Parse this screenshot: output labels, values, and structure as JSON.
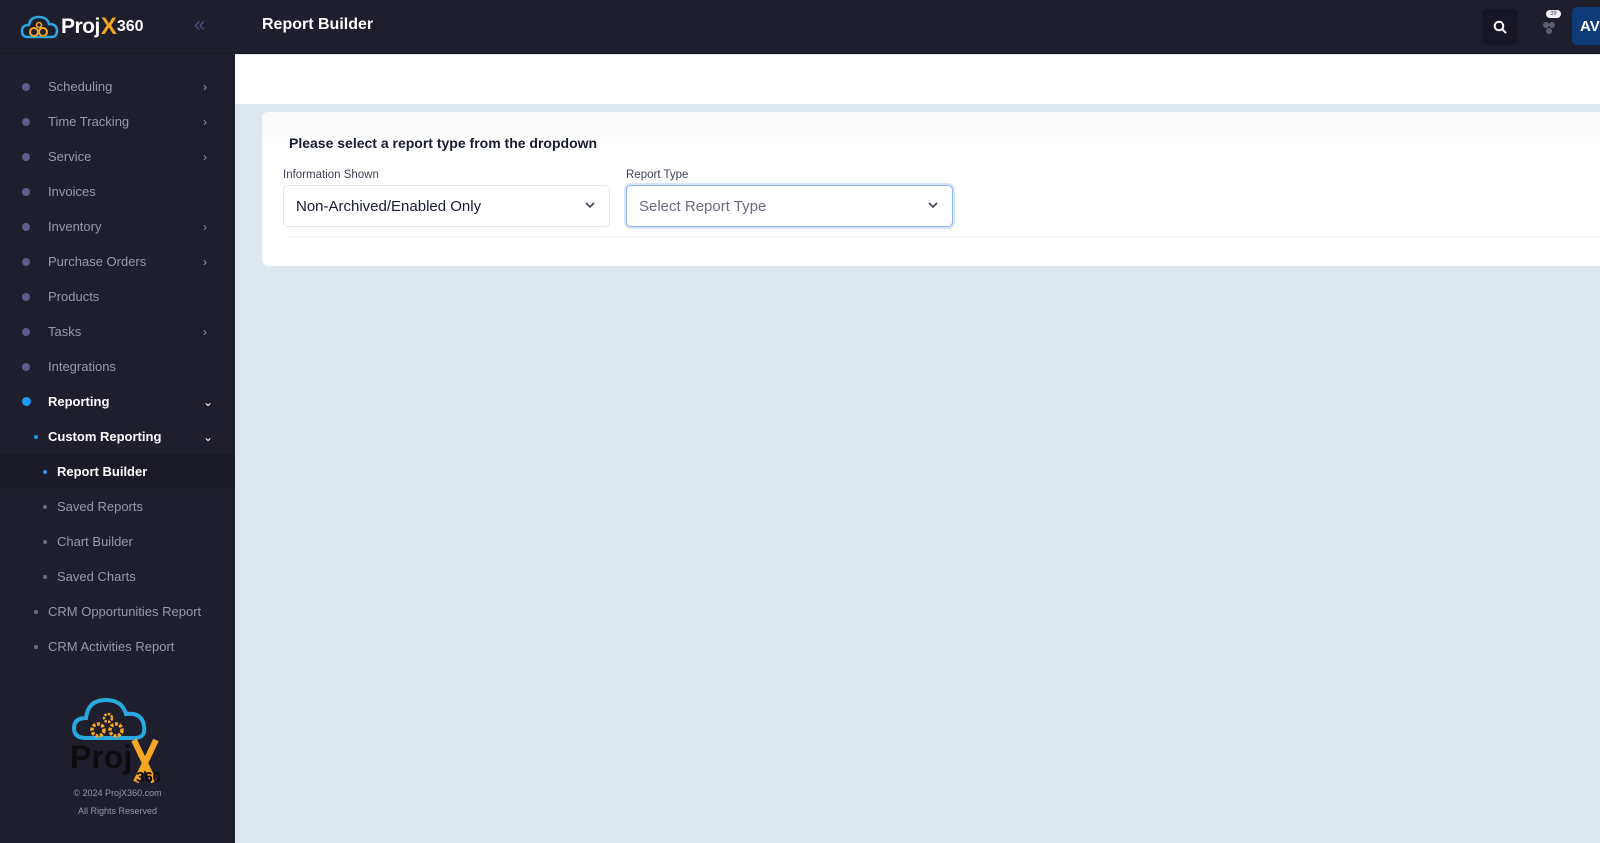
{
  "app": {
    "logo_text": "Proj",
    "logo_x": "X",
    "logo_suffix": "360",
    "collapse_icon": "«"
  },
  "header": {
    "title": "Report Builder",
    "notification_count": "39",
    "avatar_initials": "AV"
  },
  "sidebar": {
    "items": [
      {
        "label": "Scheduling",
        "has_children": true
      },
      {
        "label": "Time Tracking",
        "has_children": true
      },
      {
        "label": "Service",
        "has_children": true
      },
      {
        "label": "Invoices",
        "has_children": false
      },
      {
        "label": "Inventory",
        "has_children": true
      },
      {
        "label": "Purchase Orders",
        "has_children": true
      },
      {
        "label": "Products",
        "has_children": false
      },
      {
        "label": "Tasks",
        "has_children": true
      },
      {
        "label": "Integrations",
        "has_children": false
      },
      {
        "label": "Reporting",
        "has_children": true,
        "expanded": true
      },
      {
        "label": "Custom Reporting",
        "has_children": true,
        "expanded": true
      },
      {
        "label": "Report Builder",
        "current": true
      },
      {
        "label": "Saved Reports"
      },
      {
        "label": "Chart Builder"
      },
      {
        "label": "Saved Charts"
      },
      {
        "label": "CRM Opportunities Report"
      },
      {
        "label": "CRM Activities Report"
      }
    ],
    "footer": {
      "logo_text": "Proj",
      "logo_x": "X",
      "logo_suffix": "360",
      "copyright": "© 2024 ProjX360.com",
      "rights": "All Rights Reserved"
    }
  },
  "main": {
    "message": "Please select a report type from the dropdown",
    "information_shown": {
      "label": "Information Shown",
      "value": "Non-Archived/Enabled Only"
    },
    "report_type": {
      "label": "Report Type",
      "placeholder": "Select Report Type",
      "value": ""
    }
  },
  "colors": {
    "sidebar_bg": "#1e1e2d",
    "accent": "#1b9cf2",
    "brand_orange": "#f5a623",
    "content_bg": "#dde7ef",
    "avatar_bg": "#0d3c78"
  }
}
